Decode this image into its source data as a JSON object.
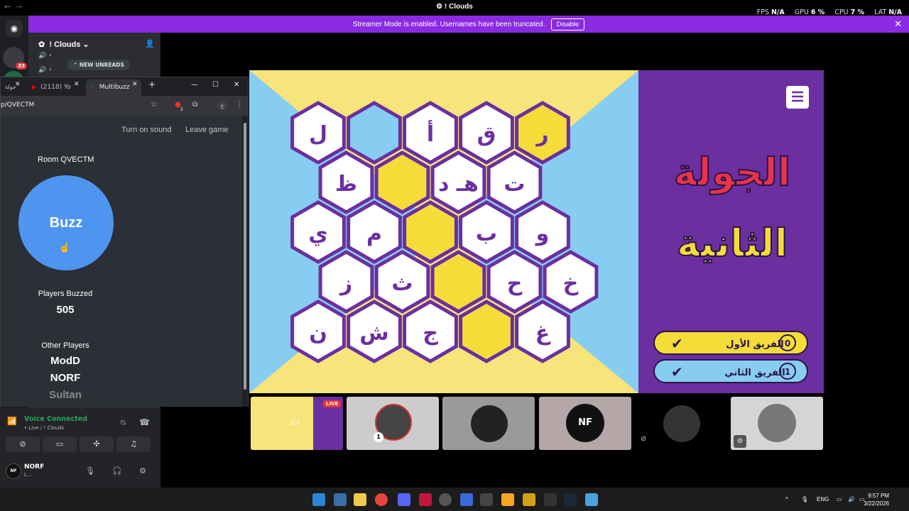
{
  "window": {
    "title": "Clouds",
    "fps_label": "FPS",
    "fps_value": "N/A",
    "gpu_label": "GPU",
    "gpu_value": "6 %",
    "cpu_label": "CPU",
    "cpu_value": "7 %",
    "lat_label": "LAT",
    "lat_value": "N/A"
  },
  "banner": {
    "text": "Streamer Mode is enabled. Usernames have been truncated.",
    "disable_label": "Disable"
  },
  "discord": {
    "server_name": "Clouds",
    "new_unreads": "NEW UNREADS",
    "badge_count": "33",
    "voice_connected": "Voice Connected",
    "voice_sub": "• Live /  ! Clouds",
    "user_name": "NORF",
    "user_status": "L..."
  },
  "browser": {
    "tabs": [
      {
        "label": "جولة"
      },
      {
        "label": "(2118) Yo"
      },
      {
        "label": "Multibuzz"
      }
    ],
    "url": "p/QVECTM",
    "ext_badge": "2"
  },
  "multibuzz": {
    "turn_on_sound": "Turn on sound",
    "leave_game": "Leave game",
    "room": "Room QVECTM",
    "buzz": "Buzz",
    "players_buzzed_label": "Players Buzzed",
    "players_buzzed_value": "505",
    "other_players_label": "Other Players",
    "other_players": [
      "ModD",
      "NORF",
      "Sultan"
    ]
  },
  "game": {
    "round_title_line1": "الجولة",
    "round_title_line2": "الثانية",
    "team1_name": "الفريق الأول",
    "team1_score": "0",
    "team2_name": "الفريق الثاني",
    "team2_score": "1",
    "colors": {
      "left_bg": "#87cdf2",
      "top_bg": "#f7e47a",
      "purple": "#6b2fa0",
      "hex_border": "#6b2fa0",
      "yellow": "#f5dc38"
    },
    "rows": [
      [
        "ل",
        "",
        "أ",
        "ق",
        "ر"
      ],
      [
        "ظ",
        "",
        "هـ د",
        "ت"
      ],
      [
        "ي",
        "م",
        "",
        "ب",
        "و"
      ],
      [
        "ز",
        "ث",
        "",
        "ح",
        "خ"
      ],
      [
        "ن",
        "ش",
        "ج",
        "",
        "غ"
      ]
    ],
    "hex_fill": [
      [
        "white",
        "blue",
        "white",
        "white",
        "yellow"
      ],
      [
        "white",
        "yellow",
        "white",
        "white"
      ],
      [
        "white",
        "white",
        "yellow",
        "white",
        "white"
      ],
      [
        "white",
        "white",
        "yellow",
        "white",
        "white"
      ],
      [
        "white",
        "white",
        "white",
        "yellow",
        "white"
      ]
    ]
  },
  "stream": {
    "live_label": "LIVE",
    "tile_nf": "NF",
    "tile_badge": "1"
  },
  "taskbar": {
    "lang": "ENG",
    "time": "9:57 PM",
    "date": "3/22/2026"
  }
}
